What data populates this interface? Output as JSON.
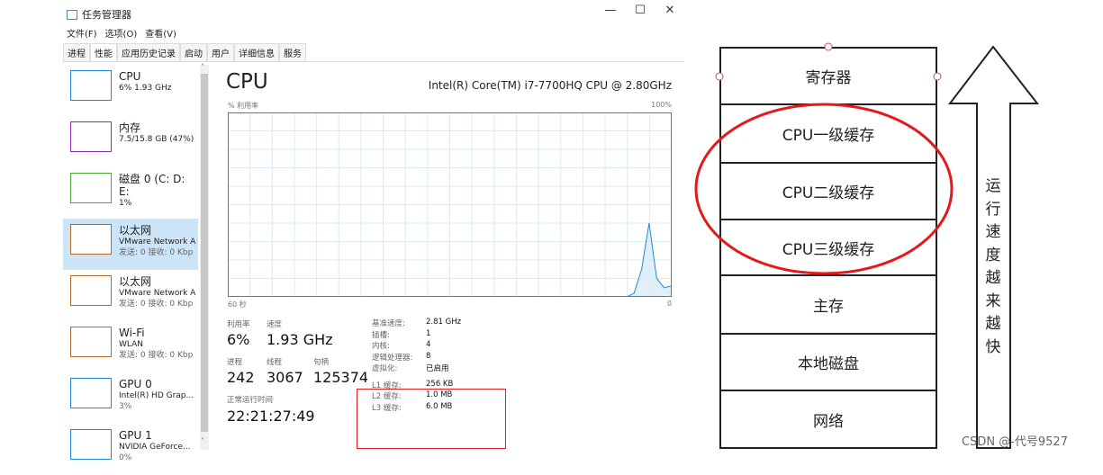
{
  "window": {
    "title": "任务管理器",
    "minimize": "—",
    "maximize": "☐",
    "close": "✕"
  },
  "menu": [
    "文件(F)",
    "选项(O)",
    "查看(V)"
  ],
  "tabs": [
    "进程",
    "性能",
    "应用历史记录",
    "启动",
    "用户",
    "详细信息",
    "服务"
  ],
  "active_tab": "性能",
  "sidebar": [
    {
      "name": "CPU",
      "l2": "6% 1.93 GHz",
      "l3": "",
      "color": "#1e8bd2"
    },
    {
      "name": "内存",
      "l2": "7.5/15.8 GB (47%)",
      "l3": "",
      "color": "#8b2fb5"
    },
    {
      "name": "磁盘 0 (C: D: E:",
      "l2": "1%",
      "l3": "",
      "color": "#4ca832"
    },
    {
      "name": "以太网",
      "l2": "VMware Network A",
      "l3": "发送: 0 接收: 0 Kbp",
      "color": "#b56a2c"
    },
    {
      "name": "以太网",
      "l2": "VMware Network A",
      "l3": "发送: 0 接收: 0 Kbp",
      "color": "#b56a2c"
    },
    {
      "name": "Wi-Fi",
      "l2": "WLAN",
      "l3": "发送: 0 接收: 0 Kbp",
      "color": "#b56a2c"
    },
    {
      "name": "GPU 0",
      "l2": "Intel(R) HD Grap...",
      "l3": "3%",
      "color": "#1e8bd2"
    },
    {
      "name": "GPU 1",
      "l2": "NVIDIA GeForce...",
      "l3": "0%",
      "color": "#1e8bd2"
    }
  ],
  "main": {
    "title": "CPU",
    "model": "Intel(R) Core(TM) i7-7700HQ CPU @ 2.80GHz",
    "y_label": "% 利用率",
    "y_max": "100%",
    "x_left": "60 秒",
    "x_right": "0",
    "chart_values": [
      0,
      0,
      0,
      0,
      0,
      0,
      0,
      0,
      0,
      0,
      0,
      0,
      0,
      0,
      0,
      0,
      0,
      0,
      0,
      0,
      0,
      0,
      0,
      0,
      0,
      0,
      0,
      0,
      0,
      0,
      0,
      0,
      0,
      0,
      0,
      0,
      0,
      0,
      0,
      0,
      0,
      0,
      0,
      0,
      0,
      0,
      0,
      0,
      0,
      0,
      0,
      0,
      0,
      0,
      2,
      15,
      40,
      10,
      5,
      6
    ],
    "util_label": "利用率",
    "util": "6%",
    "speed_label": "速度",
    "speed": "1.93 GHz",
    "proc_label": "进程",
    "proc": "242",
    "thread_label": "线程",
    "thread": "3067",
    "handle_label": "句柄",
    "handle": "125374",
    "uptime_label": "正常运行时间",
    "uptime": "22:21:27:49",
    "specs": [
      [
        "基准速度:",
        "2.81 GHz"
      ],
      [
        "插槽:",
        "1"
      ],
      [
        "内核:",
        "4"
      ],
      [
        "逻辑处理器:",
        "8"
      ],
      [
        "虚拟化:",
        "已启用"
      ]
    ],
    "cache": [
      [
        "L1 缓存:",
        "256 KB"
      ],
      [
        "L2 缓存:",
        "1.0 MB"
      ],
      [
        "L3 缓存:",
        "6.0 MB"
      ]
    ],
    "highlight_color": "#e02020"
  },
  "hierarchy": [
    "寄存器",
    "CPU一级缓存",
    "CPU二级缓存",
    "CPU三级缓存",
    "主存",
    "本地磁盘",
    "网络"
  ],
  "arrow_text": "运行速度越来越快",
  "watermark": "CSDN @-代号9527"
}
